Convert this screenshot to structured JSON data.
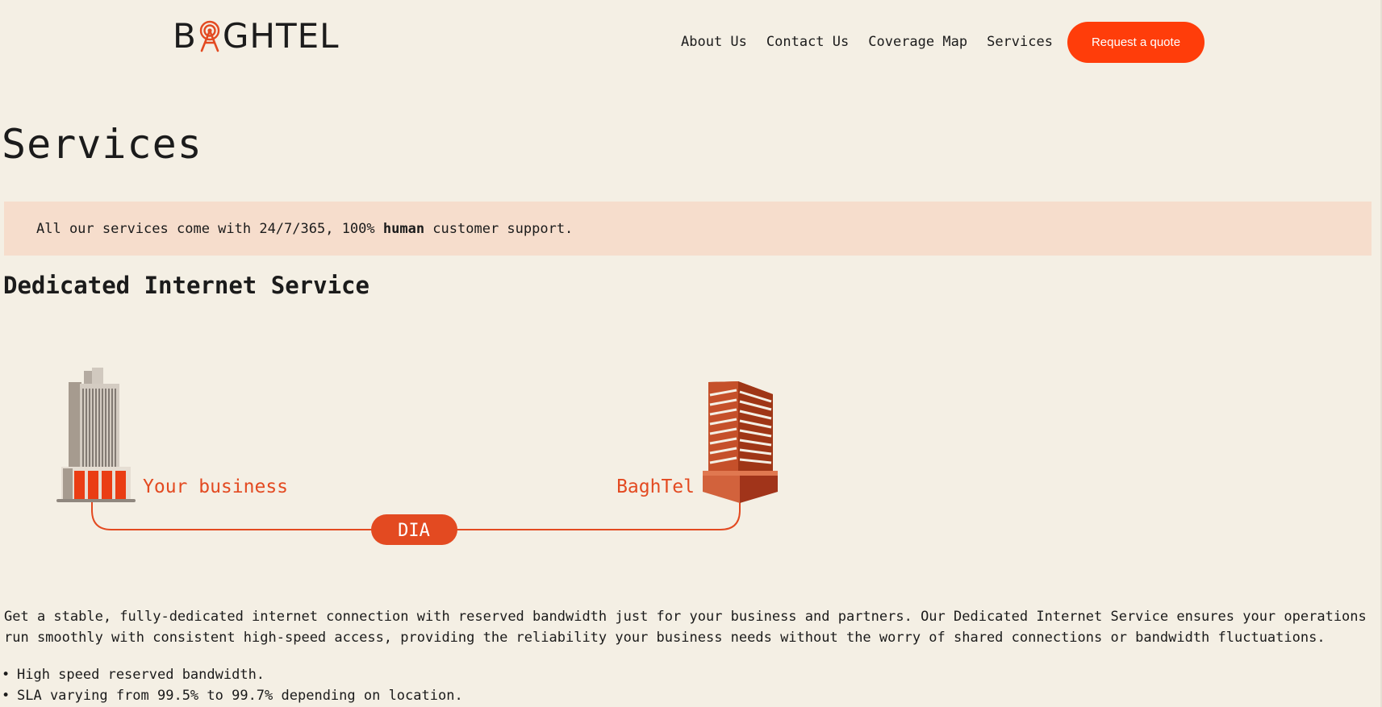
{
  "header": {
    "logo_text_start": "B",
    "logo_text_end": "GHTEL",
    "logo_icon": "antenna-tower-icon",
    "nav": [
      {
        "label": "About Us"
      },
      {
        "label": "Contact Us"
      },
      {
        "label": "Coverage Map"
      },
      {
        "label": "Services"
      }
    ],
    "cta_label": "Request a quote"
  },
  "page": {
    "title": "Services",
    "banner": {
      "before": "All our services come with 24/7/365, 100% ",
      "bold": "human",
      "after": " customer support."
    }
  },
  "section": {
    "title": "Dedicated Internet Service",
    "diagram": {
      "left_label": "Your business",
      "right_label": "BaghTel",
      "link_label": "DIA",
      "left_icon": "office-building-icon",
      "right_icon": "datacenter-building-icon"
    },
    "description": "Get a stable, fully-dedicated internet connection with reserved bandwidth just for your business and partners. Our Dedicated Internet Service ensures your operations run smoothly with consistent high-speed access, providing the reliability your business needs without the worry of shared connections or bandwidth fluctuations.",
    "features": [
      "High speed reserved bandwidth.",
      "SLA varying from 99.5% to 99.7% depending on location."
    ]
  },
  "colors": {
    "background": "#f4efe4",
    "accent": "#ff3d0a",
    "diagram_accent": "#e34a21",
    "banner": "#f6ddcc"
  }
}
